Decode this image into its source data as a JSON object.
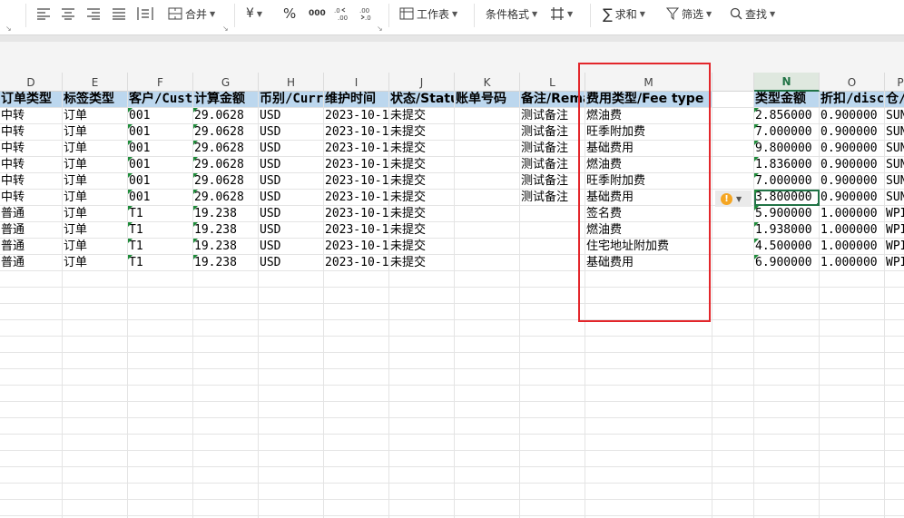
{
  "toolbar": {
    "merge_label": "合并",
    "currency_symbol": "¥",
    "percent_symbol": "%",
    "thousands_symbol": "000",
    "worksheet_label": "工作表",
    "conditional_format_label": "条件格式",
    "sum_label": "求和",
    "filter_label": "筛选",
    "find_label": "查找"
  },
  "columns": [
    "D",
    "E",
    "F",
    "G",
    "H",
    "I",
    "J",
    "K",
    "L",
    "M",
    "N",
    "O",
    "P"
  ],
  "active_column": "N",
  "header_row": [
    "订单类型",
    "标签类型",
    "客户/Customer",
    "计算金额",
    "币别/Currency",
    "维护时间",
    "状态/Status",
    "账单号码",
    "备注/Remark",
    "费用类型/Fee type",
    "",
    "类型金额",
    "折扣/discount",
    "仓/"
  ],
  "rows": [
    [
      "中转",
      "订单",
      "001",
      "29.0628",
      "USD",
      "2023-10-1",
      "未提交",
      "",
      "测试备注",
      "燃油费",
      "2.856000",
      "0.900000",
      "SUN"
    ],
    [
      "中转",
      "订单",
      "001",
      "29.0628",
      "USD",
      "2023-10-1",
      "未提交",
      "",
      "测试备注",
      "旺季附加费",
      "7.000000",
      "0.900000",
      "SUN"
    ],
    [
      "中转",
      "订单",
      "001",
      "29.0628",
      "USD",
      "2023-10-1",
      "未提交",
      "",
      "测试备注",
      "基础费用",
      "9.800000",
      "0.900000",
      "SUN"
    ],
    [
      "中转",
      "订单",
      "001",
      "29.0628",
      "USD",
      "2023-10-1",
      "未提交",
      "",
      "测试备注",
      "燃油费",
      "1.836000",
      "0.900000",
      "SUN"
    ],
    [
      "中转",
      "订单",
      "001",
      "29.0628",
      "USD",
      "2023-10-1",
      "未提交",
      "",
      "测试备注",
      "旺季附加费",
      "7.000000",
      "0.900000",
      "SUN"
    ],
    [
      "中转",
      "订单",
      "001",
      "29.0628",
      "USD",
      "2023-10-1",
      "未提交",
      "",
      "测试备注",
      "基础费用",
      "3.800000",
      "0.900000",
      "SUN"
    ],
    [
      "普通",
      "订单",
      "T1",
      "19.238",
      "USD",
      "2023-10-1",
      "未提交",
      "",
      "",
      "签名费",
      "5.900000",
      "1.000000",
      "WPI"
    ],
    [
      "普通",
      "订单",
      "T1",
      "19.238",
      "USD",
      "2023-10-1",
      "未提交",
      "",
      "",
      "燃油费",
      "1.938000",
      "1.000000",
      "WPI"
    ],
    [
      "普通",
      "订单",
      "T1",
      "19.238",
      "USD",
      "2023-10-1",
      "未提交",
      "",
      "",
      "住宅地址附加费",
      "4.500000",
      "1.000000",
      "WPI"
    ],
    [
      "普通",
      "订单",
      "T1",
      "19.238",
      "USD",
      "2023-10-1",
      "未提交",
      "",
      "",
      "基础费用",
      "6.900000",
      "1.000000",
      "WPI"
    ]
  ],
  "warning_symbol": "!",
  "colors": {
    "header_fill": "#bcd7ee",
    "accent_green": "#217346",
    "highlight_red": "#e3262b",
    "warning_orange": "#f5a623"
  }
}
